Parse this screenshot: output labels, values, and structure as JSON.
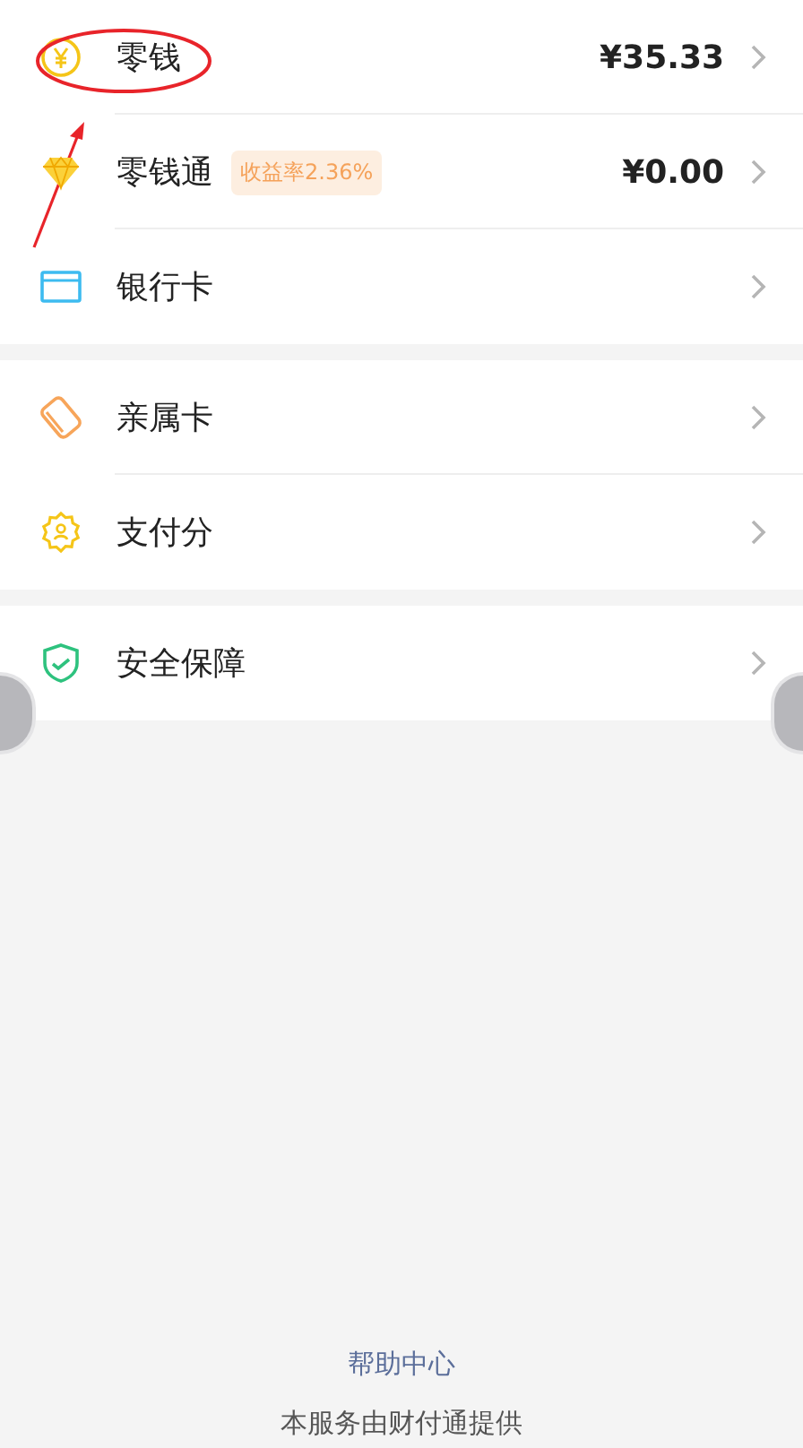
{
  "sections": [
    {
      "rows": [
        {
          "kind": "coin",
          "label": "零钱",
          "amount": "¥35.33",
          "annotated": true
        },
        {
          "kind": "diamond",
          "label": "零钱通",
          "badge": "收益率2.36%",
          "amount": "¥0.00"
        },
        {
          "kind": "card",
          "label": "银行卡"
        }
      ]
    },
    {
      "rows": [
        {
          "kind": "family",
          "label": "亲属卡"
        },
        {
          "kind": "score",
          "label": "支付分"
        }
      ]
    },
    {
      "rows": [
        {
          "kind": "shield",
          "label": "安全保障"
        }
      ]
    }
  ],
  "footer": {
    "link": "帮助中心",
    "note": "本服务由财付通提供"
  }
}
